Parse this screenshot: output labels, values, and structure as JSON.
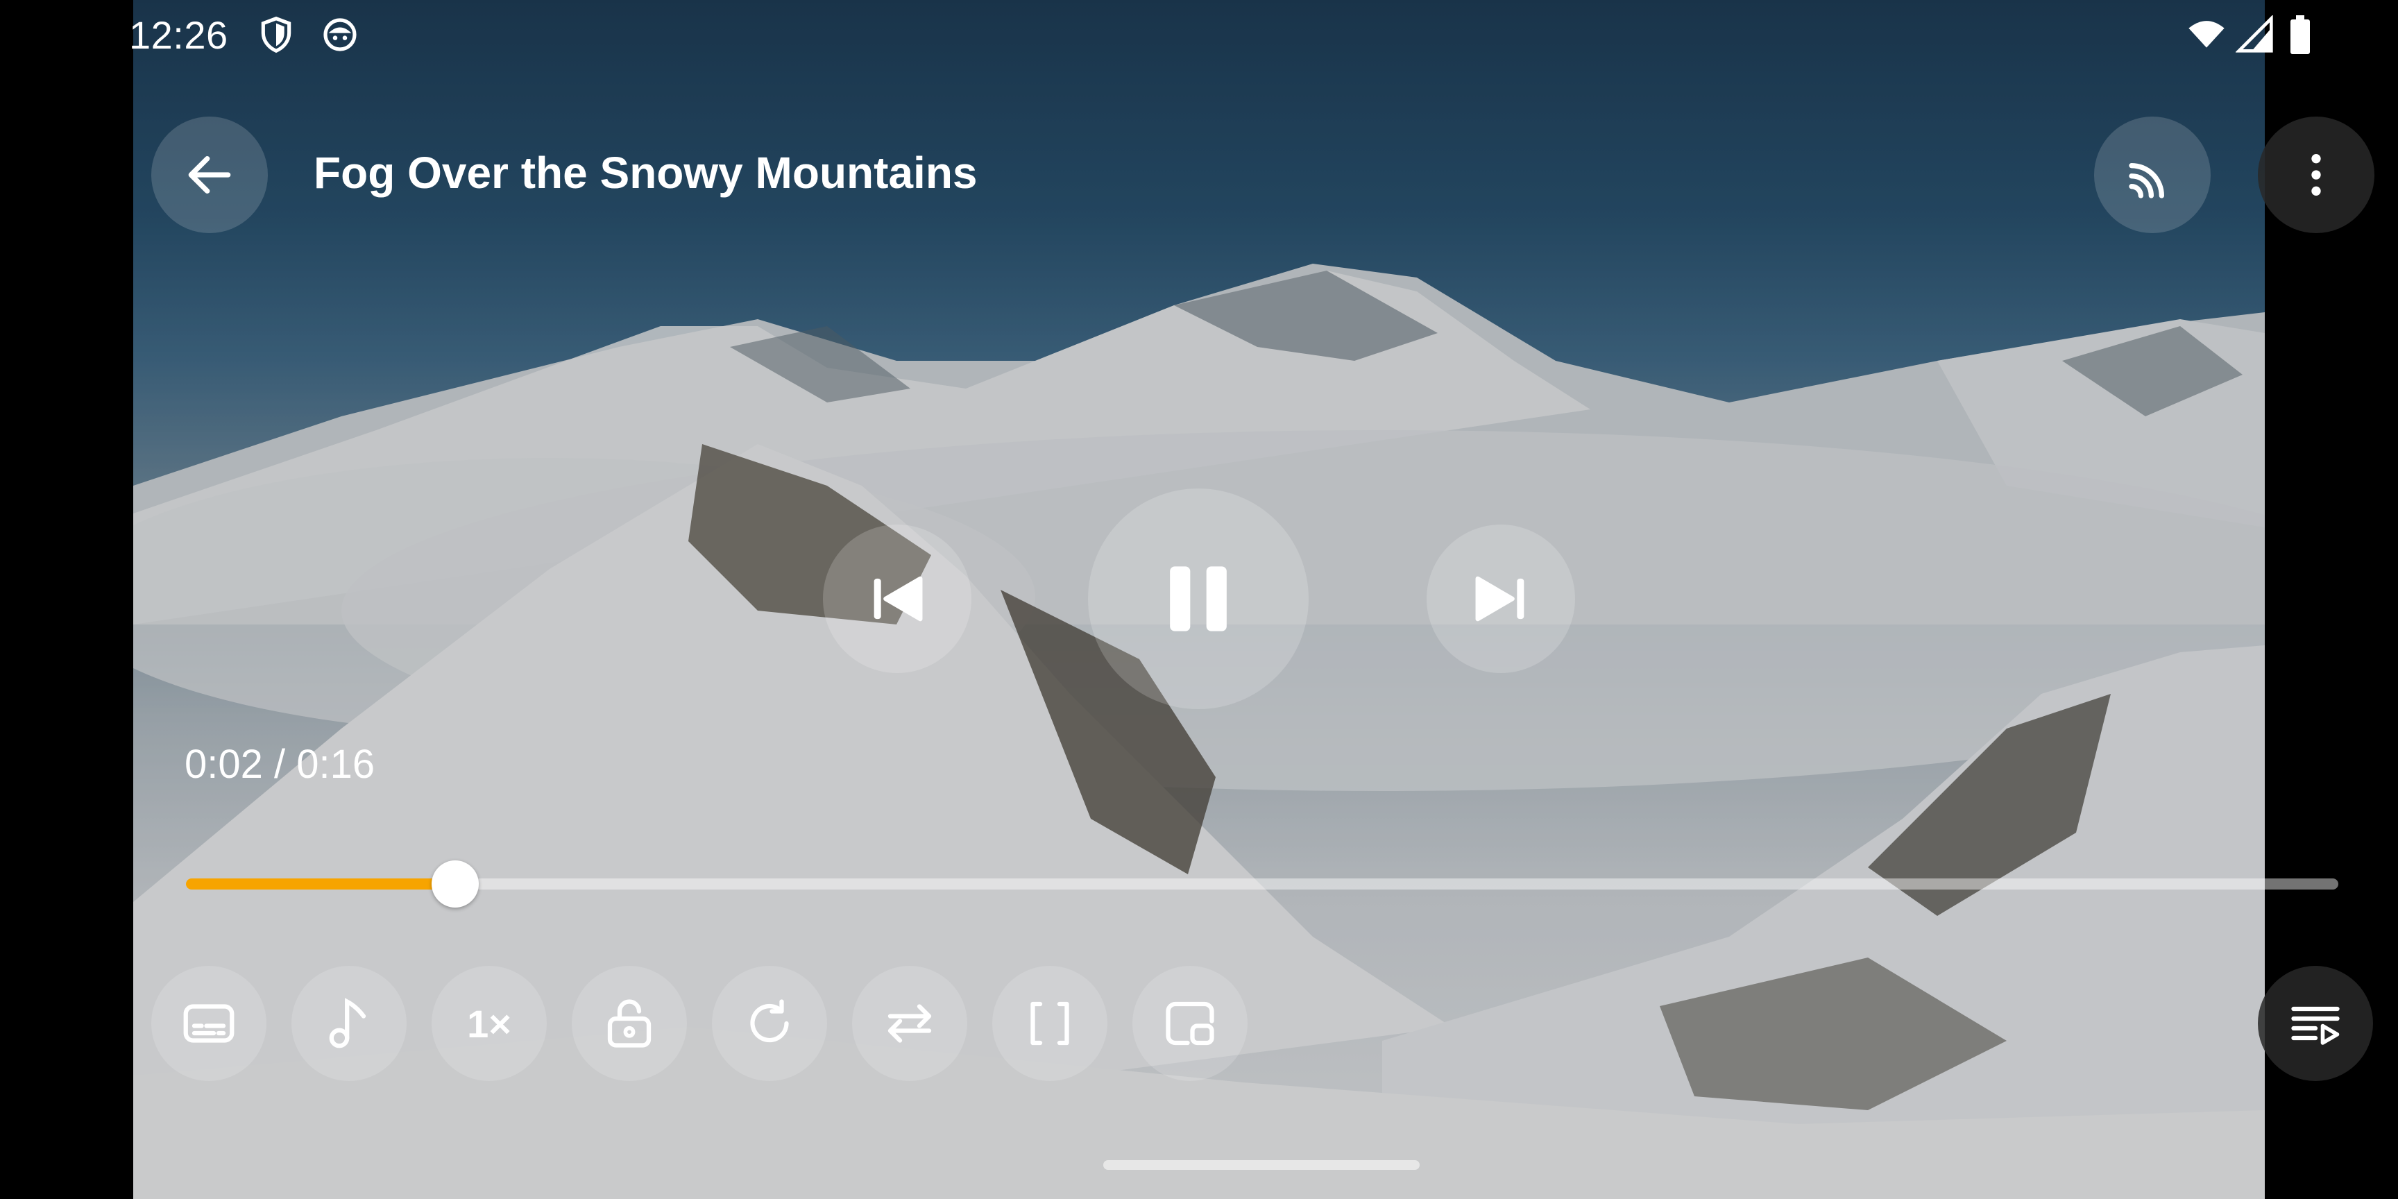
{
  "status_bar": {
    "time": "12:26",
    "icons_left": [
      "shield-icon",
      "android-face-icon"
    ],
    "icons_right": [
      "wifi-icon",
      "cell-signal-icon",
      "battery-icon"
    ]
  },
  "top_bar": {
    "title": "Fog Over the Snowy Mountains",
    "back_icon": "arrow-left-icon",
    "cast_icon": "cast-icon",
    "menu_icon": "more-vertical-icon"
  },
  "playback": {
    "current_time": "0:02",
    "duration": "0:16",
    "time_display": "0:02 / 0:16",
    "progress_fraction": 0.125,
    "state": "playing",
    "accent_color": "#f7a400"
  },
  "center_controls": {
    "previous_icon": "skip-previous-icon",
    "pause_icon": "pause-icon",
    "next_icon": "skip-next-icon"
  },
  "bottom_controls": {
    "subtitles_icon": "subtitles-icon",
    "audio_track_icon": "music-note-icon",
    "speed_label": "1×",
    "lock_icon": "lock-icon",
    "rotate_icon": "rotate-icon",
    "repeat_icon": "swap-icon",
    "aspect_icon": "aspect-brackets-icon",
    "pip_icon": "picture-in-picture-icon",
    "playlist_icon": "playlist-icon"
  }
}
